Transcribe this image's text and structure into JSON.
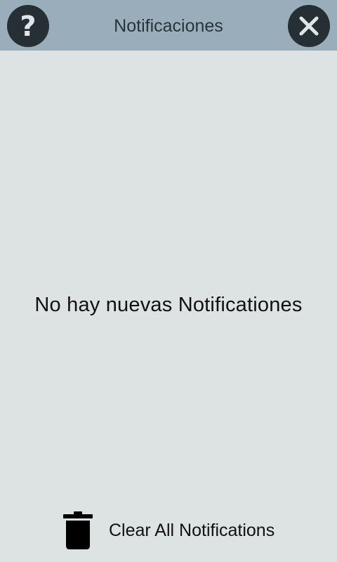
{
  "header": {
    "title": "Notificaciones",
    "help_icon": "help-circle-icon",
    "close_icon": "close-circle-icon"
  },
  "main": {
    "empty_message": "No hay nuevas Notificationes"
  },
  "footer": {
    "clear_all_label": "Clear All Notifications",
    "clear_all_icon": "trash-icon"
  },
  "colors": {
    "header_background": "#9aadba",
    "page_background": "#dde2e3",
    "button_dark": "#263034"
  }
}
